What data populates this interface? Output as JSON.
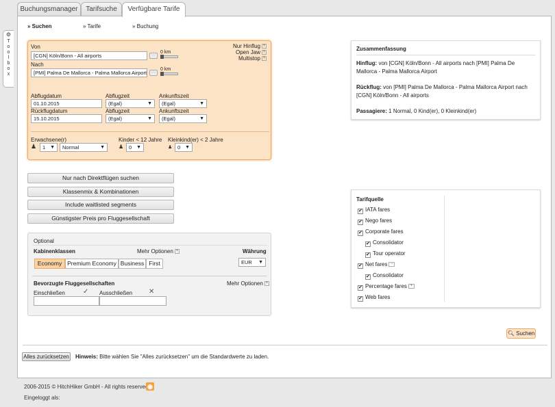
{
  "tabs": [
    "Buchungsmanager",
    "Tarifsuche",
    "Verfügbare Tarife"
  ],
  "toolbox": {
    "label": "Toolbox"
  },
  "steps": [
    "» Suchen",
    "» Tarife",
    "» Buchung"
  ],
  "search": {
    "von_label": "Von",
    "von_value": "[CGN] Köln/Bonn - All airports",
    "nach_label": "Nach",
    "nach_value": "[PMI] Palma De Mallorca - Palma Mallorca Airport",
    "km1": "0 km",
    "km2": "0 km",
    "nur_hinflug": "Nur Hinflug",
    "open_jaw": "Open Jaw",
    "multistop": "Multistop",
    "abflugdatum_label": "Abflugdatum",
    "abflugdatum_value": "01.10.2015",
    "abflugzeit_label": "Abflugzeit",
    "abflugzeit_value": "(Egal)",
    "ankunftszeit_label": "Ankunftszeit",
    "ankunftszeit_value": "(Egal)",
    "rueckflugdatum_label": "Rückflugdatum",
    "rueckflugdatum_value": "15.10.2015",
    "abflugzeit2_label": "Abflugzeit",
    "abflugzeit2_value": "(Egal)",
    "ankunftszeit2_label": "Ankunftszeit",
    "ankunftszeit2_value": "(Egal)",
    "erwachsene_label": "Erwachsene(r)",
    "erwachsene_value": "1",
    "erwachsene_type": "Normal",
    "kinder_label": "Kinder < 12 Jahre",
    "kinder_value": "0",
    "kleinkind_label": "Kleinkind(er) < 2 Jahre",
    "kleinkind_value": "0"
  },
  "buttons": {
    "direkt": "Nur nach Direktflügen suchen",
    "klassenmix": "Klassenmix & Kombinationen",
    "waitlisted": "Include waitlisted segments",
    "guenstigster": "Günstigster Preis pro Fluggesellschaft"
  },
  "optional": {
    "title": "Optional",
    "kabinen_label": "Kabinenklassen",
    "mehr_optionen": "Mehr Optionen",
    "waehrung_label": "Währung",
    "waehrung_value": "EUR",
    "classes": [
      "Economy",
      "Premium Economy",
      "Business",
      "First"
    ],
    "airlines_label": "Bevorzugte Fluggesellschaften",
    "mehr_optionen2": "Mehr Optionen",
    "einschliessen": "Einschließen",
    "ausschliessen": "Ausschließen"
  },
  "summary": {
    "title": "Zusammenfassung",
    "hinflug_label": "Hinflug:",
    "hinflug_text": " von [CGN] Köln/Bonn - All airports nach [PMI] Palma De Mallorca - Palma Mallorca Airport",
    "rueckflug_label": "Rückflug:",
    "rueckflug_text": " von [PMI] Palma De Mallorca - Palma Mallorca Airport nach [CGN] Köln/Bonn - All airports",
    "passagiere_label": "Passagiere:",
    "passagiere_text": " 1 Normal, 0 Kind(er), 0 Kleinkind(er)"
  },
  "tarifquelle": {
    "title": "Tarifquelle",
    "items": [
      "IATA fares",
      "Nego fares",
      "Corporate fares",
      "Consolidator",
      "Tour operator",
      "Net fares",
      "Consolidator",
      "Percentage fares",
      "Web fares"
    ]
  },
  "suchen_button": "Suchen",
  "reset": {
    "button": "Alles zurücksetzen",
    "hint_label": "Hinweis:",
    "hint_text": " Bitte wählen Sie \"Alles zurücksetzen\" um die Standardwerte zu laden."
  },
  "footer": {
    "copyright": "2006-2015 © HitchHiker GmbH - All rights reserved",
    "logged_in": "Eingeloggt als:"
  }
}
